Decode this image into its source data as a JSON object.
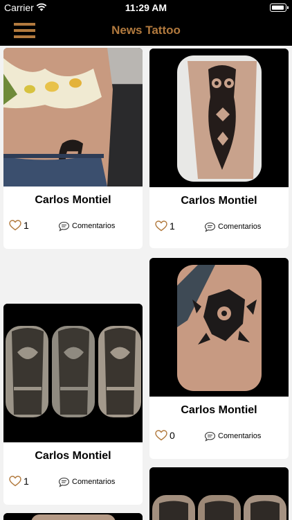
{
  "status_bar": {
    "carrier": "Carrier",
    "time": "11:29 AM"
  },
  "nav": {
    "title": "News Tattoo"
  },
  "posts": [
    {
      "author": "Carlos Montiel",
      "likes": "1",
      "comments_label": "Comentarios"
    },
    {
      "author": "Carlos Montiel",
      "likes": "1",
      "comments_label": "Comentarios"
    },
    {
      "author": "Carlos Montiel",
      "likes": "1",
      "comments_label": "Comentarios"
    },
    {
      "author": "Carlos Montiel",
      "likes": "0",
      "comments_label": "Comentarios"
    }
  ],
  "colors": {
    "accent": "#b27a3e",
    "bar_background": "#000000",
    "feed_background": "#f2f2f2"
  }
}
